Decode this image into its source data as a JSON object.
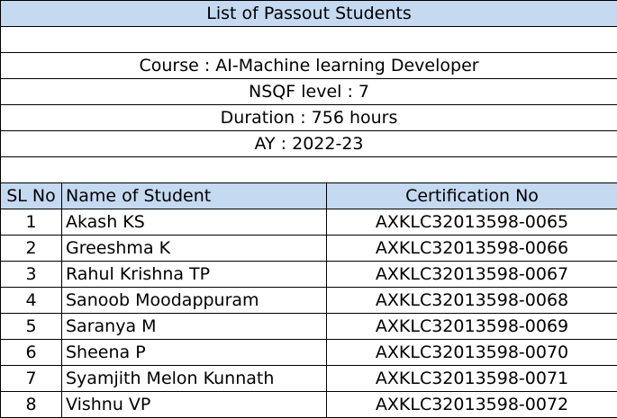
{
  "title": "List of Passout Students",
  "info": {
    "course": "Course : AI-Machine learning Developer",
    "nsqf": "NSQF level : 7",
    "duration": "Duration : 756 hours",
    "ay": "AY : 2022-23"
  },
  "columns": {
    "sl": "SL No",
    "name": "Name of Student",
    "cert": "Certification No"
  },
  "rows": [
    {
      "sl": "1",
      "name": "Akash KS",
      "cert": "AXKLC32013598-0065"
    },
    {
      "sl": "2",
      "name": "Greeshma K",
      "cert": "AXKLC32013598-0066"
    },
    {
      "sl": "3",
      "name": "Rahul Krishna TP",
      "cert": "AXKLC32013598-0067"
    },
    {
      "sl": "4",
      "name": "Sanoob Moodappuram",
      "cert": "AXKLC32013598-0068"
    },
    {
      "sl": "5",
      "name": "Saranya M",
      "cert": "AXKLC32013598-0069"
    },
    {
      "sl": "6",
      "name": "Sheena P",
      "cert": "AXKLC32013598-0070"
    },
    {
      "sl": "7",
      "name": "Syamjith Melon Kunnath",
      "cert": "AXKLC32013598-0071"
    },
    {
      "sl": "8",
      "name": "Vishnu VP",
      "cert": "AXKLC32013598-0072"
    }
  ],
  "colors": {
    "header_fill": "#c5d9f1",
    "border": "#000000"
  }
}
